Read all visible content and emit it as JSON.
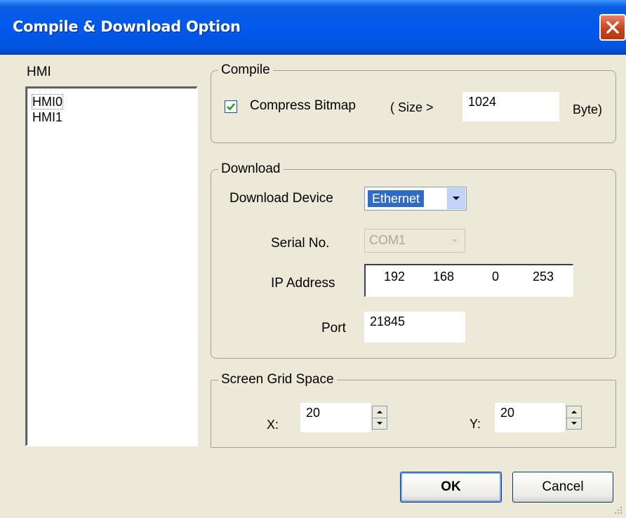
{
  "window": {
    "title": "Compile & Download Option"
  },
  "hmi": {
    "label": "HMI",
    "items": [
      "HMI0",
      "HMI1"
    ],
    "selected_index": 0
  },
  "compile": {
    "legend": "Compile",
    "compress_bitmap_label": "Compress Bitmap",
    "compress_bitmap_checked": true,
    "size_prefix": "( Size >",
    "size_value": "1024",
    "size_unit": "Byte)"
  },
  "download": {
    "legend": "Download",
    "device_label": "Download Device",
    "device_value": "Ethernet",
    "serial_label": "Serial No.",
    "serial_value": "COM1",
    "ip_label": "IP Address",
    "ip_octets": [
      "192",
      "168",
      "0",
      "253"
    ],
    "port_label": "Port",
    "port_value": "21845"
  },
  "grid": {
    "legend": "Screen Grid Space",
    "x_label": "X:",
    "x_value": "20",
    "y_label": "Y:",
    "y_value": "20"
  },
  "buttons": {
    "ok": "OK",
    "cancel": "Cancel"
  },
  "colors": {
    "titlebar": "#0058ee",
    "close": "#c7441e",
    "selection": "#316ac5",
    "face": "#ece9d8"
  }
}
